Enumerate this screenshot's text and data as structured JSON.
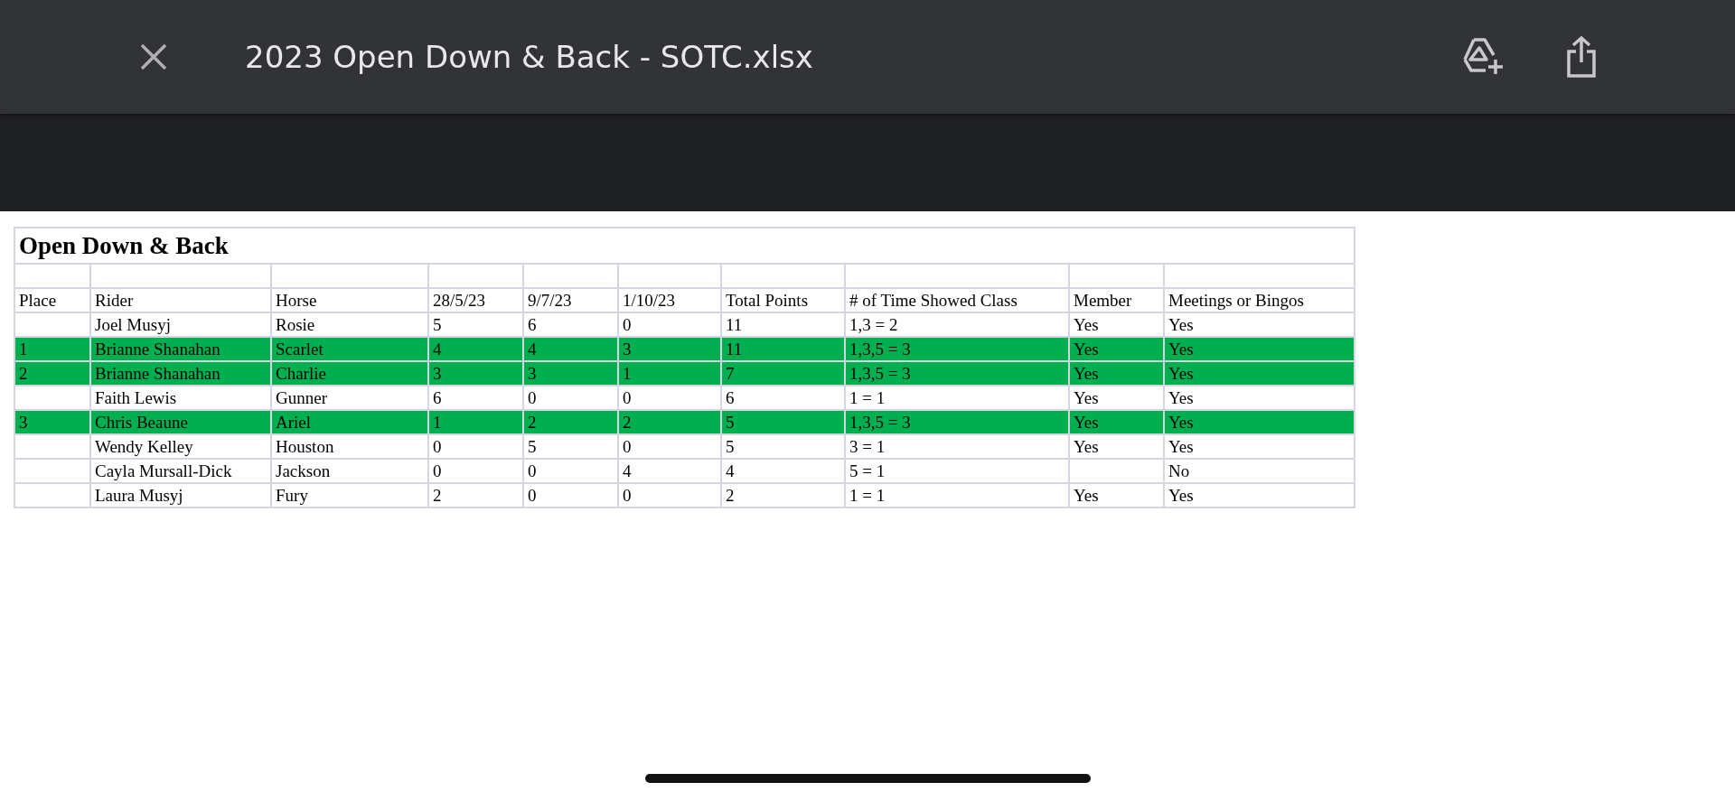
{
  "window": {
    "title": "2023 Open Down & Back - SOTC.xlsx"
  },
  "sheet": {
    "title": "Open Down & Back",
    "columns": [
      "Place",
      "Rider",
      "Horse",
      "28/5/23",
      "9/7/23",
      "1/10/23",
      "Total Points",
      "# of Time Showed Class",
      "Member",
      "Meetings or Bingos"
    ],
    "rows": [
      {
        "highlighted": false,
        "cells": [
          "",
          "Joel Musyj",
          "Rosie",
          "5",
          "6",
          "0",
          "11",
          "1,3 = 2",
          "Yes",
          "Yes"
        ]
      },
      {
        "highlighted": true,
        "cells": [
          "1",
          "Brianne Shanahan",
          "Scarlet",
          "4",
          "4",
          "3",
          "11",
          "1,3,5 = 3",
          "Yes",
          "Yes"
        ]
      },
      {
        "highlighted": true,
        "cells": [
          "2",
          "Brianne Shanahan",
          "Charlie",
          "3",
          "3",
          "1",
          "7",
          "1,3,5 = 3",
          "Yes",
          "Yes"
        ]
      },
      {
        "highlighted": false,
        "cells": [
          "",
          "Faith Lewis",
          "Gunner",
          "6",
          "0",
          "0",
          "6",
          "1 = 1",
          "Yes",
          "Yes"
        ]
      },
      {
        "highlighted": true,
        "cells": [
          "3",
          "Chris Beaune",
          "Ariel",
          "1",
          "2",
          "2",
          "5",
          "1,3,5 = 3",
          "Yes",
          "Yes"
        ]
      },
      {
        "highlighted": false,
        "cells": [
          "",
          "Wendy Kelley",
          "Houston",
          "0",
          "5",
          "0",
          "5",
          "3 = 1",
          "Yes",
          "Yes"
        ]
      },
      {
        "highlighted": false,
        "cells": [
          "",
          "Cayla Mursall-Dick",
          "Jackson",
          "0",
          "0",
          "4",
          "4",
          "5 = 1",
          "",
          "No"
        ]
      },
      {
        "highlighted": false,
        "cells": [
          "",
          "Laura Musyj",
          "Fury",
          "2",
          "0",
          "0",
          "2",
          "1 = 1",
          "Yes",
          "Yes"
        ]
      }
    ]
  }
}
